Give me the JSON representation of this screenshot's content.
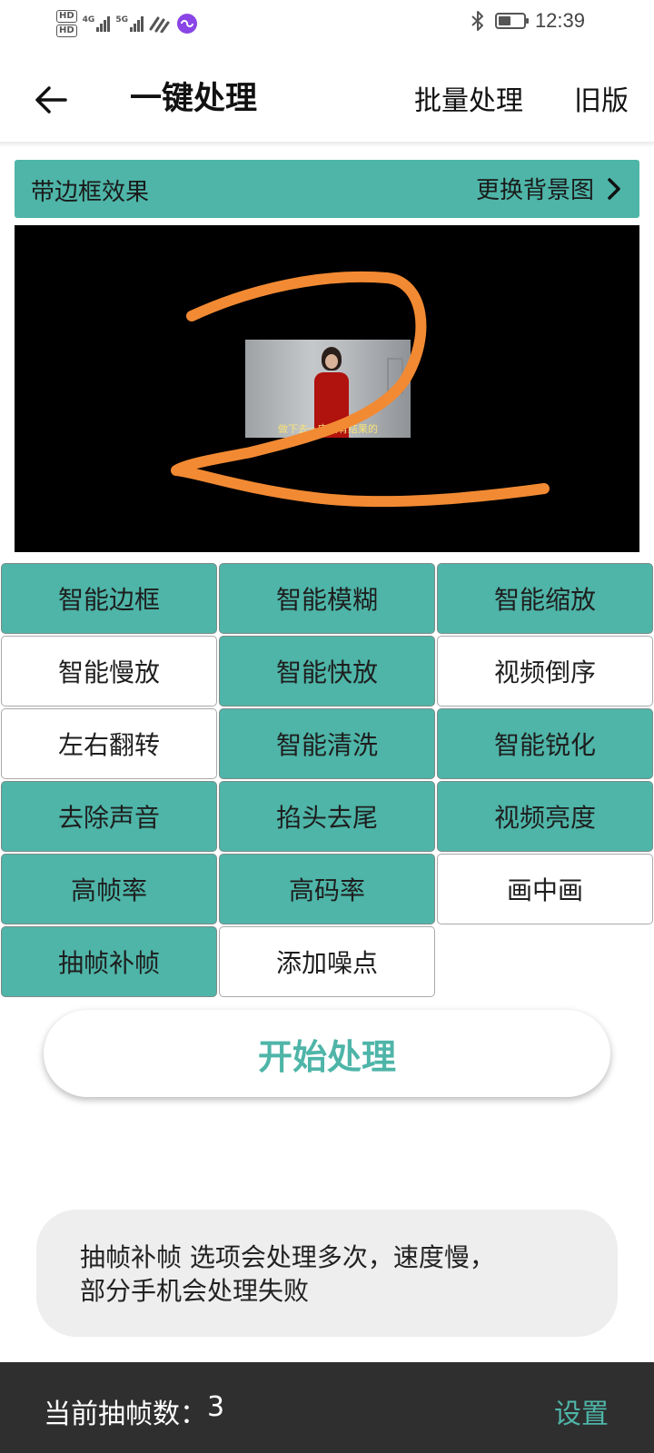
{
  "status_bar": {
    "sim1": "HD",
    "sim2": "HD",
    "net1": "4G",
    "net2": "5G",
    "time": "12:39",
    "battery_level": 0.5
  },
  "header": {
    "title": "一键处理",
    "batch_label": "批量处理",
    "old_label": "旧版"
  },
  "frame_bar": {
    "label": "带边框效果",
    "change_bg_label": "更换背景图"
  },
  "preview": {
    "caption": "做下去一定会有结果的"
  },
  "options": [
    {
      "label": "智能边框",
      "active": true
    },
    {
      "label": "智能模糊",
      "active": true
    },
    {
      "label": "智能缩放",
      "active": true
    },
    {
      "label": "智能慢放",
      "active": false
    },
    {
      "label": "智能快放",
      "active": true
    },
    {
      "label": "视频倒序",
      "active": false
    },
    {
      "label": "左右翻转",
      "active": false
    },
    {
      "label": "智能清洗",
      "active": true
    },
    {
      "label": "智能锐化",
      "active": true
    },
    {
      "label": "去除声音",
      "active": true
    },
    {
      "label": "掐头去尾",
      "active": true
    },
    {
      "label": "视频亮度",
      "active": true
    },
    {
      "label": "高帧率",
      "active": true
    },
    {
      "label": "高码率",
      "active": true
    },
    {
      "label": "画中画",
      "active": false
    },
    {
      "label": "抽帧补帧",
      "active": true
    },
    {
      "label": "添加噪点",
      "active": false
    }
  ],
  "start_button": "开始处理",
  "toast": {
    "line1": "抽帧补帧 选项会处理多次，速度慢，",
    "line2": "部分手机会处理失败"
  },
  "bottom_bar": {
    "frame_count_label": "当前抽帧数：",
    "frame_count_value": "3",
    "settings_label": "设置"
  },
  "colors": {
    "accent": "#4eb5a8",
    "stroke": "#f28a33",
    "bottom_bar": "#2f2f2f"
  }
}
